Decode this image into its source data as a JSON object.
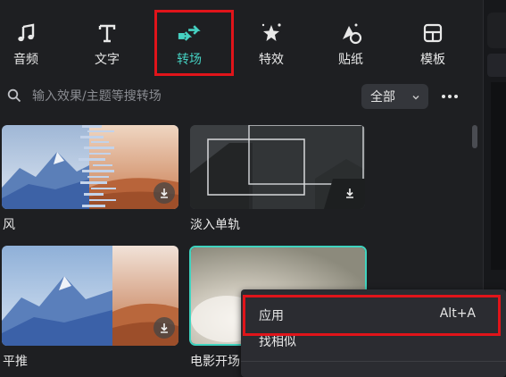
{
  "toolbar": {
    "items": [
      {
        "label": "音频",
        "icon": "music-note-icon"
      },
      {
        "label": "文字",
        "icon": "text-t-icon"
      },
      {
        "label": "转场",
        "icon": "transition-arrows-icon",
        "active": true
      },
      {
        "label": "特效",
        "icon": "sparkle-star-icon"
      },
      {
        "label": "贴纸",
        "icon": "sticker-icon"
      },
      {
        "label": "模板",
        "icon": "template-grid-icon"
      }
    ]
  },
  "search": {
    "placeholder": "输入效果/主题等搜转场",
    "filter_label": "全部"
  },
  "cards": [
    {
      "label": "风"
    },
    {
      "label": "淡入单轨"
    },
    {
      "label": "平推"
    },
    {
      "label": "电影开场"
    }
  ],
  "context_menu": {
    "items": [
      {
        "label": "应用",
        "shortcut": "Alt+A"
      },
      {
        "label": "找相似",
        "shortcut": ""
      }
    ]
  },
  "colors": {
    "accent": "#45d0c1",
    "highlight_box": "#e0141a",
    "background": "#1e1f22"
  }
}
